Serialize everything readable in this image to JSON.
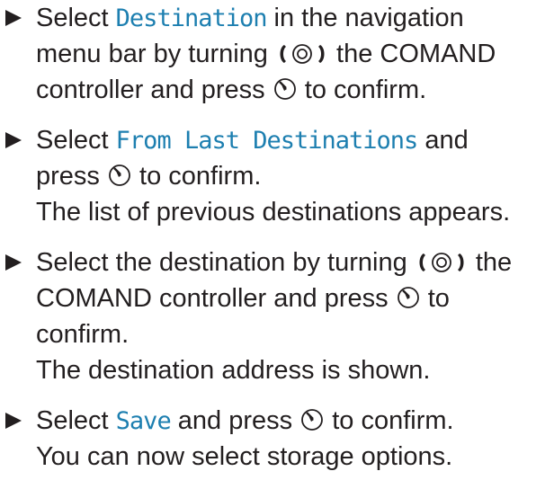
{
  "steps": [
    {
      "lines": [
        {
          "pre": "Select ",
          "mono": "Destination",
          "post": " in the navigation"
        },
        {
          "pre": "menu bar by turning ",
          "post": " the COMAND"
        },
        {
          "pre": "controller and press ",
          "post": " to confirm."
        }
      ]
    },
    {
      "lines": [
        {
          "pre": "Select ",
          "mono": "From Last Destinations",
          "post": " and"
        },
        {
          "pre": "press ",
          "post": " to confirm."
        },
        {
          "text": "The list of previous destinations appears."
        }
      ]
    },
    {
      "lines": [
        {
          "pre": "Select the destination by turning ",
          "post": " the"
        },
        {
          "pre": "COMAND controller and press ",
          "post": " to"
        },
        {
          "text": "confirm."
        },
        {
          "text": "The destination address is shown."
        }
      ]
    },
    {
      "lines": [
        {
          "pre": "Select ",
          "mono": "Save",
          "post": " and press "
        },
        {
          "text": "You can now select storage options."
        }
      ],
      "line0_tail": " to confirm."
    }
  ],
  "icons": {
    "rotate": "rotary-controller-turn-icon",
    "press": "controller-press-icon"
  }
}
